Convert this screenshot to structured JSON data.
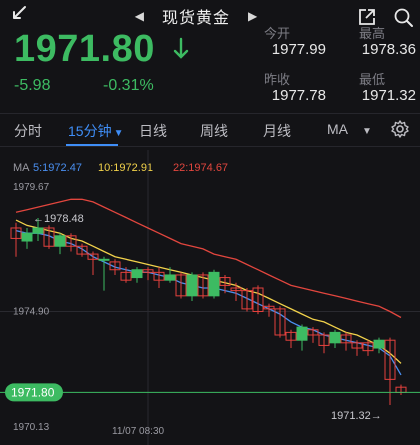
{
  "header": {
    "title": "现货黄金",
    "prev_arrow": "◀",
    "next_arrow": "▶"
  },
  "quote": {
    "price": "1971.80",
    "change": "-5.98",
    "change_pct": "-0.31%",
    "open_label": "今开",
    "open": "1977.99",
    "high_label": "最高",
    "high": "1978.36",
    "prev_close_label": "昨收",
    "prev_close": "1977.78",
    "low_label": "最低",
    "low": "1971.32"
  },
  "tabs": [
    {
      "label": "分时",
      "active": false
    },
    {
      "label": "15分钟",
      "active": true
    },
    {
      "label": "日线",
      "active": false
    },
    {
      "label": "周线",
      "active": false
    },
    {
      "label": "月线",
      "active": false
    },
    {
      "label": "MA",
      "active": false
    }
  ],
  "colors": {
    "up": "#3dbb62",
    "down": "#e5413d",
    "accent": "#3f8ef7",
    "ma5": "#4a8ff0",
    "ma10": "#f2d24b",
    "ma22": "#e2463e",
    "background": "#131316"
  },
  "ma_legend": {
    "ma_label": "MA",
    "ma5": "5:1972.47",
    "ma10": "10:1972.91",
    "ma22": "22:1974.67"
  },
  "chart_data": {
    "type": "candlestick",
    "y_labels": [
      "1979.67",
      "1974.90",
      "1970.13"
    ],
    "ylim": [
      1970.13,
      1979.67
    ],
    "x_label": "11/07 08:30",
    "last_price_label": "1971.80",
    "max_annotation": "1978.48",
    "min_annotation": "1971.32",
    "candles": [
      {
        "o": 1978.1,
        "c": 1977.7,
        "h": 1978.3,
        "l": 1977.0
      },
      {
        "o": 1977.6,
        "c": 1977.9,
        "h": 1978.1,
        "l": 1977.3
      },
      {
        "o": 1977.9,
        "c": 1978.1,
        "h": 1978.48,
        "l": 1977.6
      },
      {
        "o": 1978.1,
        "c": 1977.4,
        "h": 1978.2,
        "l": 1977.3
      },
      {
        "o": 1977.4,
        "c": 1977.8,
        "h": 1977.9,
        "l": 1977.1
      },
      {
        "o": 1977.8,
        "c": 1977.4,
        "h": 1977.9,
        "l": 1977.2
      },
      {
        "o": 1977.4,
        "c": 1977.1,
        "h": 1977.5,
        "l": 1977.0
      },
      {
        "o": 1977.1,
        "c": 1976.9,
        "h": 1977.2,
        "l": 1976.3
      },
      {
        "o": 1976.9,
        "c": 1976.9,
        "h": 1977.0,
        "l": 1975.7
      },
      {
        "o": 1976.8,
        "c": 1976.5,
        "h": 1976.9,
        "l": 1976.3
      },
      {
        "o": 1976.4,
        "c": 1976.1,
        "h": 1976.6,
        "l": 1976.0
      },
      {
        "o": 1976.2,
        "c": 1976.5,
        "h": 1976.6,
        "l": 1976.0
      },
      {
        "o": 1976.5,
        "c": 1976.4,
        "h": 1976.6,
        "l": 1976.1
      },
      {
        "o": 1976.4,
        "c": 1976.1,
        "h": 1976.6,
        "l": 1975.8
      },
      {
        "o": 1976.1,
        "c": 1976.3,
        "h": 1976.6,
        "l": 1976.0
      },
      {
        "o": 1976.3,
        "c": 1975.5,
        "h": 1976.4,
        "l": 1975.4
      },
      {
        "o": 1975.5,
        "c": 1976.3,
        "h": 1976.4,
        "l": 1975.3
      },
      {
        "o": 1976.3,
        "c": 1975.5,
        "h": 1976.4,
        "l": 1975.4
      },
      {
        "o": 1975.5,
        "c": 1976.4,
        "h": 1976.5,
        "l": 1975.4
      },
      {
        "o": 1976.2,
        "c": 1975.9,
        "h": 1976.3,
        "l": 1975.6
      },
      {
        "o": 1975.8,
        "c": 1975.7,
        "h": 1976.0,
        "l": 1975.3
      },
      {
        "o": 1975.7,
        "c": 1975.0,
        "h": 1975.8,
        "l": 1974.9
      },
      {
        "o": 1975.8,
        "c": 1974.9,
        "h": 1975.9,
        "l": 1974.8
      },
      {
        "o": 1975.1,
        "c": 1975.0,
        "h": 1975.2,
        "l": 1974.7
      },
      {
        "o": 1975.0,
        "c": 1974.0,
        "h": 1975.1,
        "l": 1973.9
      },
      {
        "o": 1974.1,
        "c": 1973.8,
        "h": 1974.2,
        "l": 1973.5
      },
      {
        "o": 1973.8,
        "c": 1974.3,
        "h": 1974.4,
        "l": 1973.4
      },
      {
        "o": 1974.2,
        "c": 1974.0,
        "h": 1974.3,
        "l": 1973.7
      },
      {
        "o": 1974.0,
        "c": 1973.6,
        "h": 1974.1,
        "l": 1973.3
      },
      {
        "o": 1973.7,
        "c": 1974.1,
        "h": 1974.2,
        "l": 1973.5
      },
      {
        "o": 1974.0,
        "c": 1973.7,
        "h": 1974.1,
        "l": 1973.4
      },
      {
        "o": 1973.7,
        "c": 1973.5,
        "h": 1973.8,
        "l": 1973.2
      },
      {
        "o": 1973.7,
        "c": 1973.4,
        "h": 1973.8,
        "l": 1973.2
      },
      {
        "o": 1973.5,
        "c": 1973.8,
        "h": 1973.9,
        "l": 1973.3
      },
      {
        "o": 1973.8,
        "c": 1972.3,
        "h": 1973.9,
        "l": 1971.32
      },
      {
        "o": 1972.0,
        "c": 1971.8,
        "h": 1972.1,
        "l": 1971.7
      }
    ],
    "ma5": [
      1978.0,
      1977.9,
      1977.9,
      1977.8,
      1977.6,
      1977.5,
      1977.3,
      1977.0,
      1976.8,
      1976.6,
      1976.5,
      1976.4,
      1976.4,
      1976.3,
      1976.2,
      1976.0,
      1975.9,
      1975.8,
      1975.8,
      1975.7,
      1975.6,
      1975.4,
      1975.2,
      1975.0,
      1974.8,
      1974.5,
      1974.3,
      1974.2,
      1974.0,
      1973.9,
      1973.8,
      1973.7,
      1973.6,
      1973.5,
      1973.2,
      1972.47
    ],
    "ma10": [
      1978.4,
      1978.2,
      1978.1,
      1978.0,
      1977.9,
      1977.7,
      1977.6,
      1977.4,
      1977.2,
      1977.0,
      1976.9,
      1976.8,
      1976.7,
      1976.6,
      1976.5,
      1976.4,
      1976.3,
      1976.2,
      1976.1,
      1976.0,
      1975.9,
      1975.7,
      1975.6,
      1975.4,
      1975.2,
      1975.0,
      1974.8,
      1974.6,
      1974.5,
      1974.3,
      1974.1,
      1974.0,
      1973.8,
      1973.6,
      1973.3,
      1972.91
    ],
    "ma22": [
      1978.7,
      1978.8,
      1978.9,
      1979.0,
      1979.1,
      1979.2,
      1979.2,
      1979.1,
      1978.9,
      1978.7,
      1978.5,
      1978.3,
      1978.1,
      1977.9,
      1977.7,
      1977.5,
      1977.4,
      1977.3,
      1977.1,
      1977.0,
      1976.9,
      1976.7,
      1976.5,
      1976.3,
      1976.1,
      1975.9,
      1975.8,
      1975.7,
      1975.6,
      1975.5,
      1975.4,
      1975.3,
      1975.2,
      1975.1,
      1974.9,
      1974.67
    ]
  }
}
